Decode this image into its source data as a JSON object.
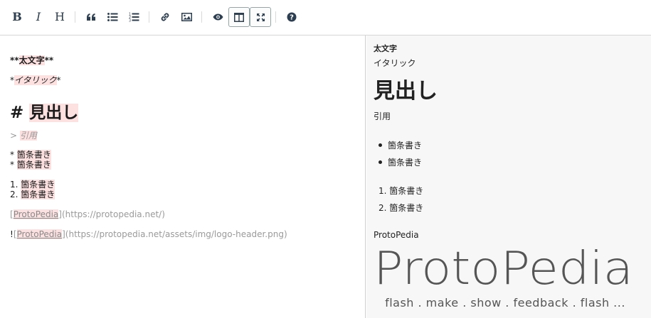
{
  "toolbar": {
    "bold": "B",
    "italic": "I",
    "heading": "H",
    "help": "?"
  },
  "editor": {
    "line_bold": {
      "prefix": "**",
      "text": "太文字",
      "suffix": "**"
    },
    "line_italic": {
      "prefix": "*",
      "text": "イタリック",
      "suffix": "*"
    },
    "line_heading": {
      "prefix": "# ",
      "text": "見出し"
    },
    "line_quote": {
      "prefix": "> ",
      "text": "引用"
    },
    "bullets": [
      {
        "prefix": "* ",
        "text": "箇条書き"
      },
      {
        "prefix": "* ",
        "text": "箇条書き"
      }
    ],
    "numbered": [
      {
        "prefix": "1. ",
        "text": "箇条書き"
      },
      {
        "prefix": "2. ",
        "text": "箇条書き"
      }
    ],
    "link": {
      "open": "[",
      "text": "ProtoPedia",
      "close": "]",
      "url": "(https://protopedia.net/)"
    },
    "image": {
      "bang": "!",
      "open": "[",
      "text": "ProtoPedia",
      "close": "]",
      "url": "(https://protopedia.net/assets/img/logo-header.png)"
    }
  },
  "preview": {
    "bold": "太文字",
    "italic": "イタリック",
    "heading": "見出し",
    "quote": "引用",
    "bullets": [
      "箇条書き",
      "箇条書き"
    ],
    "numbered": [
      "1. 箇条書き",
      "2. 箇条書き"
    ],
    "link": "ProtoPedia",
    "logo": {
      "wordmark": "ProtoPedia",
      "tagline": "flash . make . show . feedback . flash ...",
      "color": "#555555"
    }
  },
  "colors": {
    "highlight": "#fde0e0",
    "toolbar_icon": "#2c3e50",
    "preview_bg": "#f7f7f7"
  }
}
